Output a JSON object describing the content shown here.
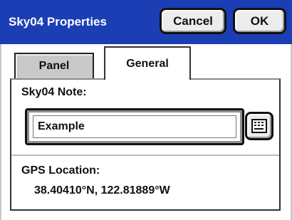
{
  "window": {
    "title": "Sky04 Properties",
    "cancel_label": "Cancel",
    "ok_label": "OK"
  },
  "tabs": [
    {
      "label": "Panel",
      "active": false
    },
    {
      "label": "General",
      "active": true
    }
  ],
  "general": {
    "note_label": "Sky04 Note:",
    "note_value": "Example",
    "keyboard_button_icon": "keyboard-icon",
    "gps_label": "GPS Location:",
    "gps_value": "38.40410°N, 122.81889°W"
  },
  "colors": {
    "titlebar": "#1c3eb4",
    "title_text": "#ffffff",
    "button_face": "#ececec",
    "inactive_tab": "#c9c9c9"
  }
}
